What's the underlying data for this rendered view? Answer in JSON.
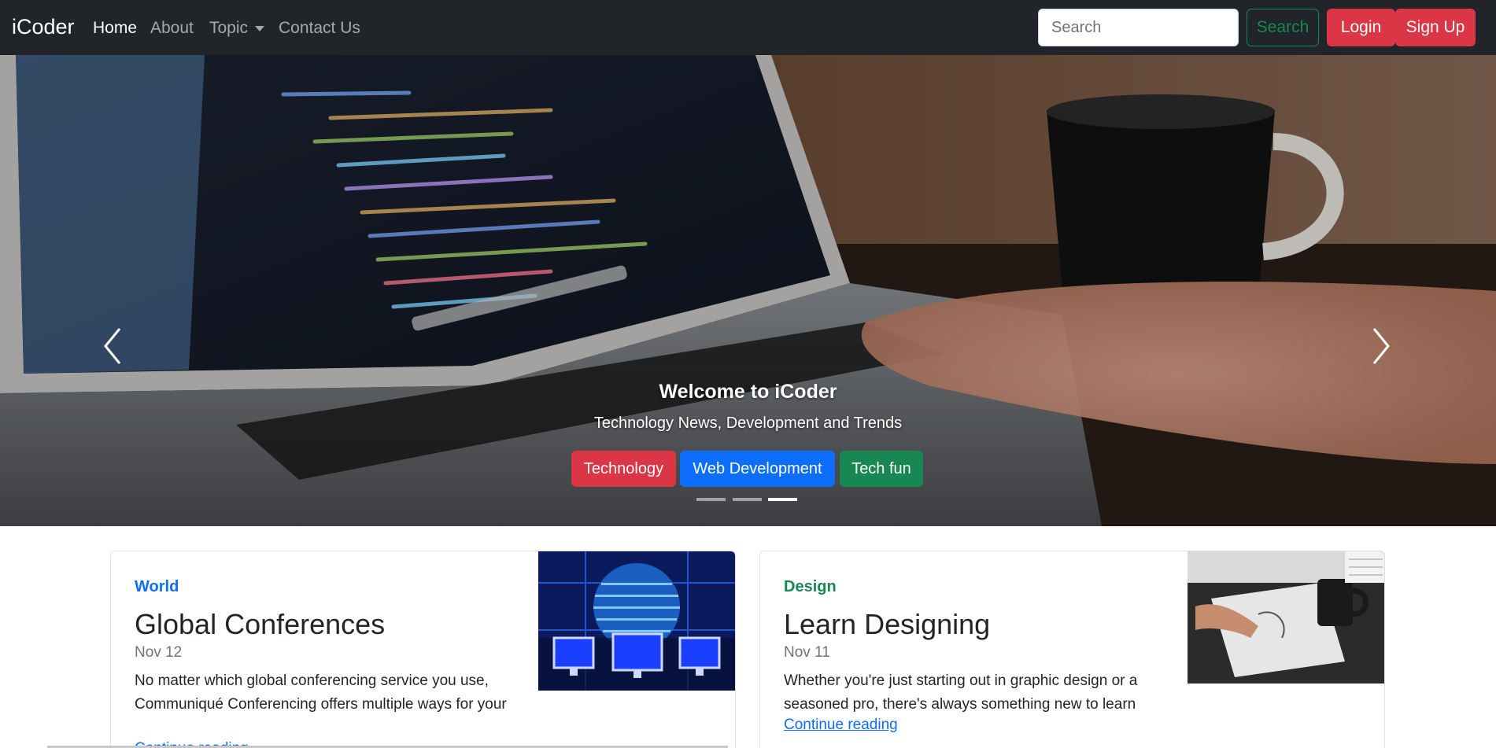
{
  "navbar": {
    "brand": "iCoder",
    "links": [
      "Home",
      "About",
      "Topic",
      "Contact Us"
    ],
    "search_placeholder": "Search",
    "search_button": "Search",
    "login_button": "Login",
    "signup_button": "Sign Up",
    "bg_color": "#212529"
  },
  "hero": {
    "title": "Welcome to iCoder",
    "subtitle": "Technology News, Development and Trends",
    "buttons": [
      "Technology",
      "Web Development",
      "Tech fun"
    ],
    "active_slide": 3,
    "slide_count": 3,
    "image_icon": "laptop-coding-photo"
  },
  "cards": [
    {
      "category": "World",
      "title": "Global Conferences",
      "date": "Nov 12",
      "text": "No matter which global conferencing service you use, Communiqué Conferencing offers multiple ways for your",
      "link": "Continue reading",
      "image_icon": "global-conference-photo",
      "category_color": "#0d6efd"
    },
    {
      "category": "Design",
      "title": "Learn Designing",
      "date": "Nov 11",
      "text": "Whether you're just starting out in graphic design or a seasoned pro, there's always something new to learn",
      "link": "Continue reading",
      "image_icon": "designer-sketching-photo",
      "category_color": "#198754"
    }
  ],
  "colors": {
    "danger": "#dc3545",
    "primary": "#0d6efd",
    "success": "#198754"
  }
}
